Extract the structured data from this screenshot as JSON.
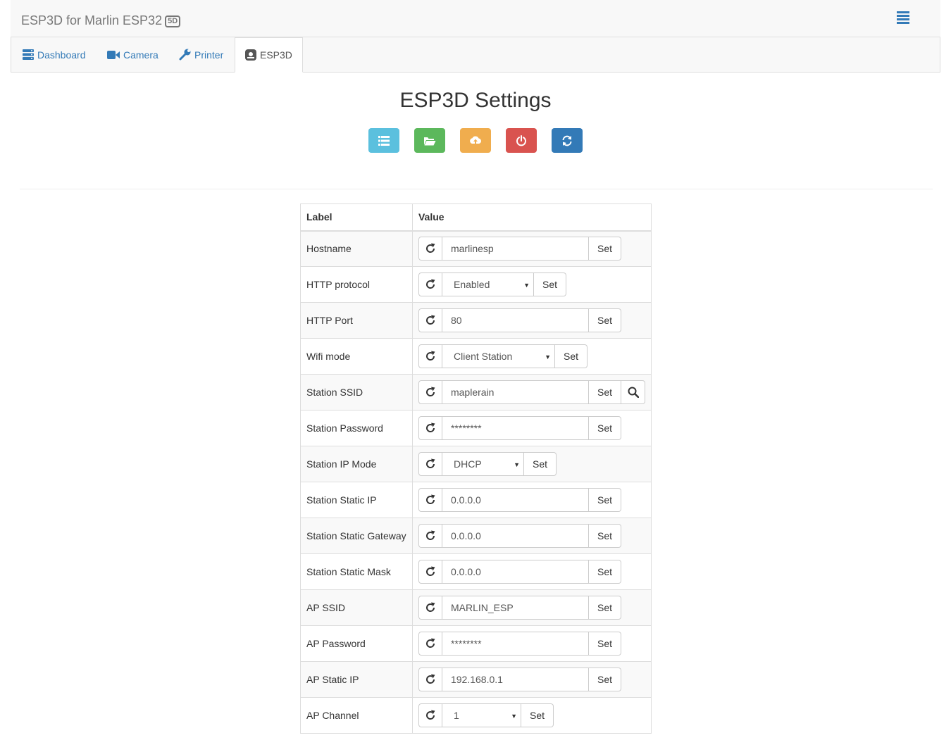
{
  "navbar": {
    "brand": "ESP3D for Marlin ESP32",
    "brand_badge": "5D",
    "menu_icon": "menu-icon"
  },
  "tabs": [
    {
      "label": "Dashboard",
      "icon": "dashboard-icon",
      "active": false
    },
    {
      "label": "Camera",
      "icon": "camera-icon",
      "active": false
    },
    {
      "label": "Printer",
      "icon": "wrench-icon",
      "active": false
    },
    {
      "label": "ESP3D",
      "icon": "esp3d-icon",
      "active": true
    }
  ],
  "page": {
    "title": "ESP3D Settings",
    "actions": [
      {
        "icon": "list-icon",
        "color": "#5bc0de"
      },
      {
        "icon": "folder-open-icon",
        "color": "#5cb85c"
      },
      {
        "icon": "cloud-upload-icon",
        "color": "#f0ad4e"
      },
      {
        "icon": "power-icon",
        "color": "#d9534f"
      },
      {
        "icon": "refresh-icon",
        "color": "#337ab7"
      }
    ]
  },
  "table": {
    "headers": {
      "label": "Label",
      "value": "Value"
    },
    "set_label": "Set",
    "rows": [
      {
        "label": "Hostname",
        "type": "text",
        "value": "marlinesp"
      },
      {
        "label": "HTTP protocol",
        "type": "select",
        "value": "Enabled"
      },
      {
        "label": "HTTP Port",
        "type": "text",
        "value": "80"
      },
      {
        "label": "Wifi mode",
        "type": "select",
        "value": "Client Station"
      },
      {
        "label": "Station SSID",
        "type": "text",
        "value": "maplerain",
        "search": true
      },
      {
        "label": "Station Password",
        "type": "text",
        "value": "********"
      },
      {
        "label": "Station IP Mode",
        "type": "select",
        "value": "DHCP"
      },
      {
        "label": "Station Static IP",
        "type": "text",
        "value": "0.0.0.0"
      },
      {
        "label": "Station Static Gateway",
        "type": "text",
        "value": "0.0.0.0"
      },
      {
        "label": "Station Static Mask",
        "type": "text",
        "value": "0.0.0.0"
      },
      {
        "label": "AP SSID",
        "type": "text",
        "value": "MARLIN_ESP"
      },
      {
        "label": "AP Password",
        "type": "text",
        "value": "********"
      },
      {
        "label": "AP Static IP",
        "type": "text",
        "value": "192.168.0.1"
      },
      {
        "label": "AP Channel",
        "type": "select",
        "value": "1"
      }
    ]
  }
}
